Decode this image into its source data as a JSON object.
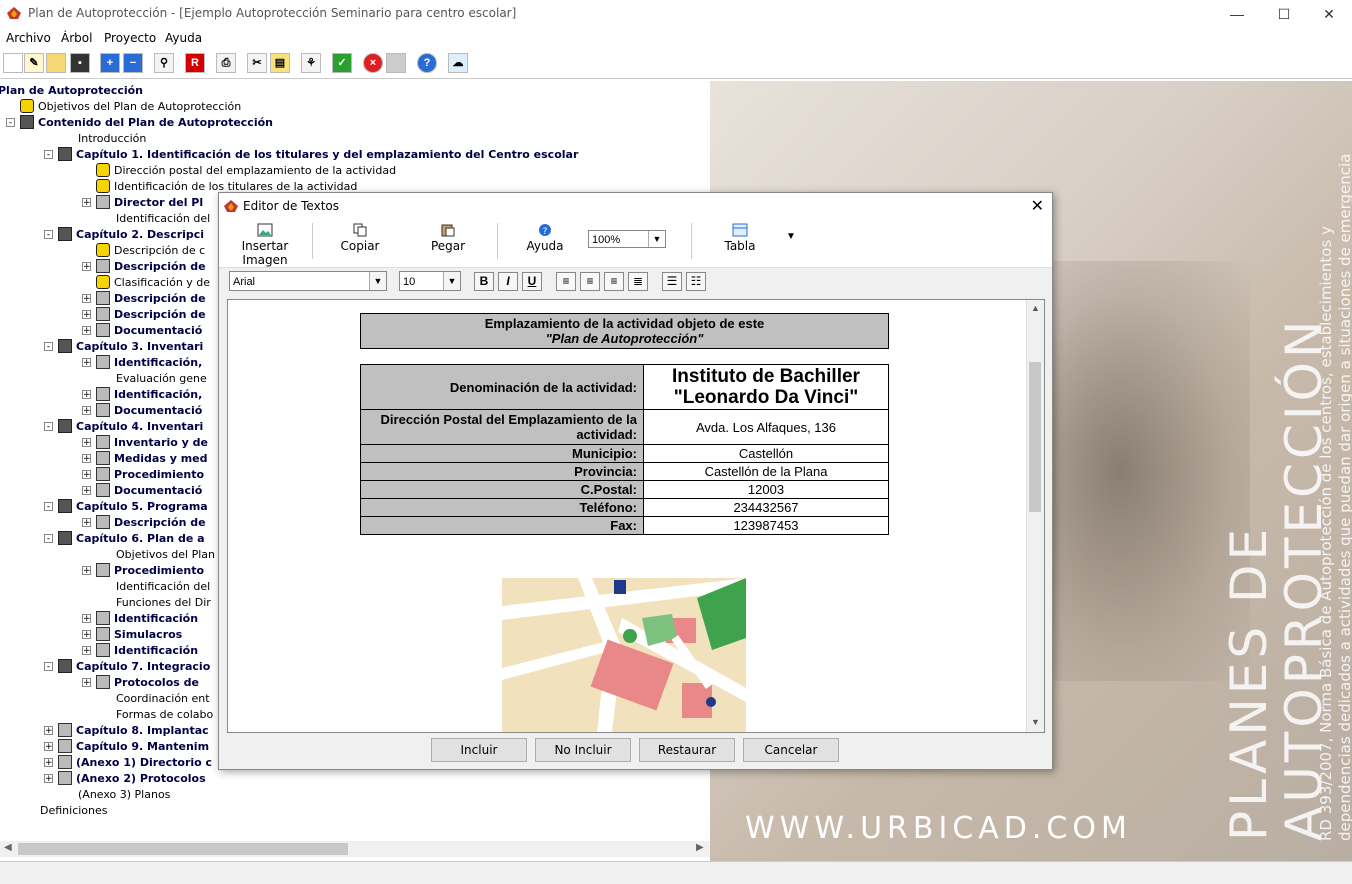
{
  "window": {
    "title": "Plan de Autoprotección - [Ejemplo Autoprotección Seminario para centro escolar]"
  },
  "menu": [
    "Archivo",
    "Árbol",
    "Proyecto",
    "Ayuda"
  ],
  "tree": [
    {
      "label": "Plan de Autoprotección",
      "bold": true,
      "level": 0,
      "icon": "flame-icon",
      "pm": ""
    },
    {
      "label": "Objetivos del Plan de Autoprotección",
      "bold": false,
      "level": 1,
      "icon": "warn-icon",
      "pm": ""
    },
    {
      "label": "Contenido del Plan de Autoprotección",
      "bold": true,
      "level": 1,
      "icon": "book-icon",
      "pm": "-"
    },
    {
      "label": "Introducción",
      "bold": false,
      "level": 2,
      "icon": "",
      "pm": ""
    },
    {
      "label": "Capítulo 1. Identificación de los titulares y del emplazamiento del Centro escolar",
      "bold": true,
      "level": 2,
      "icon": "book-icon",
      "pm": "-"
    },
    {
      "label": "Dirección postal del emplazamiento de la actividad",
      "bold": false,
      "level": 3,
      "icon": "warn-icon",
      "pm": ""
    },
    {
      "label": "Identificación de los titulares de la actividad",
      "bold": false,
      "level": 3,
      "icon": "warn-icon",
      "pm": ""
    },
    {
      "label": "Director del Pl",
      "bold": true,
      "level": 3,
      "icon": "doc-icon",
      "pm": "+"
    },
    {
      "label": "Identificación del",
      "bold": false,
      "level": 3,
      "icon": "",
      "pm": ""
    },
    {
      "label": "Capítulo 2. Descripci",
      "bold": true,
      "level": 2,
      "icon": "book-icon",
      "pm": "-"
    },
    {
      "label": "Descripción de c",
      "bold": false,
      "level": 3,
      "icon": "warn-icon",
      "pm": ""
    },
    {
      "label": "Descripción de",
      "bold": true,
      "level": 3,
      "icon": "doc-icon",
      "pm": "+"
    },
    {
      "label": "Clasificación y de",
      "bold": false,
      "level": 3,
      "icon": "warn-icon",
      "pm": ""
    },
    {
      "label": "Descripción de",
      "bold": true,
      "level": 3,
      "icon": "doc-icon",
      "pm": "+"
    },
    {
      "label": "Descripción de",
      "bold": true,
      "level": 3,
      "icon": "doc-icon",
      "pm": "+"
    },
    {
      "label": "Documentació",
      "bold": true,
      "level": 3,
      "icon": "doc-icon",
      "pm": "+"
    },
    {
      "label": "Capítulo 3. Inventari",
      "bold": true,
      "level": 2,
      "icon": "book-icon",
      "pm": "-"
    },
    {
      "label": "Identificación,",
      "bold": true,
      "level": 3,
      "icon": "doc-icon",
      "pm": "+"
    },
    {
      "label": "Evaluación gene",
      "bold": false,
      "level": 3,
      "icon": "",
      "pm": ""
    },
    {
      "label": "Identificación,",
      "bold": true,
      "level": 3,
      "icon": "doc-icon",
      "pm": "+"
    },
    {
      "label": "Documentació",
      "bold": true,
      "level": 3,
      "icon": "doc-icon",
      "pm": "+"
    },
    {
      "label": "Capítulo 4. Inventari",
      "bold": true,
      "level": 2,
      "icon": "book-icon",
      "pm": "-"
    },
    {
      "label": "Inventario y de",
      "bold": true,
      "level": 3,
      "icon": "doc-icon",
      "pm": "+"
    },
    {
      "label": "Medidas y med",
      "bold": true,
      "level": 3,
      "icon": "doc-icon",
      "pm": "+"
    },
    {
      "label": "Procedimiento",
      "bold": true,
      "level": 3,
      "icon": "doc-icon",
      "pm": "+"
    },
    {
      "label": "Documentació",
      "bold": true,
      "level": 3,
      "icon": "doc-icon",
      "pm": "+"
    },
    {
      "label": "Capítulo 5. Programa",
      "bold": true,
      "level": 2,
      "icon": "book-icon",
      "pm": "-"
    },
    {
      "label": "Descripción de",
      "bold": true,
      "level": 3,
      "icon": "doc-icon",
      "pm": "+"
    },
    {
      "label": "Capítulo 6. Plan de a",
      "bold": true,
      "level": 2,
      "icon": "book-icon",
      "pm": "-"
    },
    {
      "label": "Objetivos del Plan",
      "bold": false,
      "level": 3,
      "icon": "",
      "pm": ""
    },
    {
      "label": "Procedimiento",
      "bold": true,
      "level": 3,
      "icon": "doc-icon",
      "pm": "+"
    },
    {
      "label": "Identificación del",
      "bold": false,
      "level": 3,
      "icon": "",
      "pm": ""
    },
    {
      "label": "Funciones del Dir",
      "bold": false,
      "level": 3,
      "icon": "",
      "pm": ""
    },
    {
      "label": "Identificación",
      "bold": true,
      "level": 3,
      "icon": "doc-icon",
      "pm": "+"
    },
    {
      "label": "Simulacros",
      "bold": true,
      "level": 3,
      "icon": "doc-icon",
      "pm": "+"
    },
    {
      "label": "Identificación",
      "bold": true,
      "level": 3,
      "icon": "doc-icon",
      "pm": "+"
    },
    {
      "label": "Capítulo 7. Integracio",
      "bold": true,
      "level": 2,
      "icon": "book-icon",
      "pm": "-"
    },
    {
      "label": "Protocolos de",
      "bold": true,
      "level": 3,
      "icon": "doc-icon",
      "pm": "+"
    },
    {
      "label": "Coordinación ent",
      "bold": false,
      "level": 3,
      "icon": "",
      "pm": ""
    },
    {
      "label": "Formas de colabo",
      "bold": false,
      "level": 3,
      "icon": "",
      "pm": ""
    },
    {
      "label": "Capítulo 8. Implantac",
      "bold": true,
      "level": 2,
      "icon": "doc-icon",
      "pm": "+"
    },
    {
      "label": "Capítulo 9. Mantenim",
      "bold": true,
      "level": 2,
      "icon": "doc-icon",
      "pm": "+"
    },
    {
      "label": "(Anexo 1) Directorio c",
      "bold": true,
      "level": 2,
      "icon": "doc-icon",
      "pm": "+"
    },
    {
      "label": "(Anexo 2) Protocolos",
      "bold": true,
      "level": 2,
      "icon": "doc-icon",
      "pm": "+"
    },
    {
      "label": "(Anexo 3) Planos",
      "bold": false,
      "level": 2,
      "icon": "",
      "pm": ""
    },
    {
      "label": "Definiciones",
      "bold": false,
      "level": 1,
      "icon": "",
      "pm": ""
    }
  ],
  "background": {
    "url": "WWW.URBICAD.COM",
    "big1": "PLANES DE",
    "big2": "AUTOPROTECCIÓN",
    "small1": "RD 393/2007, Norma Básica de Autoprotección de los centros, establecimientos y",
    "small2": "dependencias dedicados a actividades que puedan dar origen a situaciones de emergencia"
  },
  "dialog": {
    "title": "Editor de Textos",
    "toolbar": {
      "insert_image": "Insertar Imagen",
      "copy": "Copiar",
      "paste": "Pegar",
      "help": "Ayuda",
      "zoom": "100%",
      "table": "Tabla"
    },
    "font": "Arial",
    "size": "10",
    "format_buttons": {
      "bold": "B",
      "italic": "I",
      "underline": "U"
    },
    "doc": {
      "header_line1": "Emplazamiento de la actividad objeto de este",
      "header_line2": "\"Plan de Autoprotección\"",
      "rows": [
        {
          "label": "Denominación de la actividad:",
          "value": "Instituto de Bachiller \"Leonardo Da Vinci\""
        },
        {
          "label": "Dirección Postal del Emplazamiento de la actividad:",
          "value": "Avda. Los Alfaques, 136"
        },
        {
          "label": "Municipio:",
          "value": "Castellón"
        },
        {
          "label": "Provincia:",
          "value": "Castellón de la Plana"
        },
        {
          "label": "C.Postal:",
          "value": "12003"
        },
        {
          "label": "Teléfono:",
          "value": "234432567"
        },
        {
          "label": "Fax:",
          "value": "123987453"
        }
      ]
    },
    "buttons": {
      "include": "Incluir",
      "no_include": "No Incluir",
      "restore": "Restaurar",
      "cancel": "Cancelar"
    }
  }
}
